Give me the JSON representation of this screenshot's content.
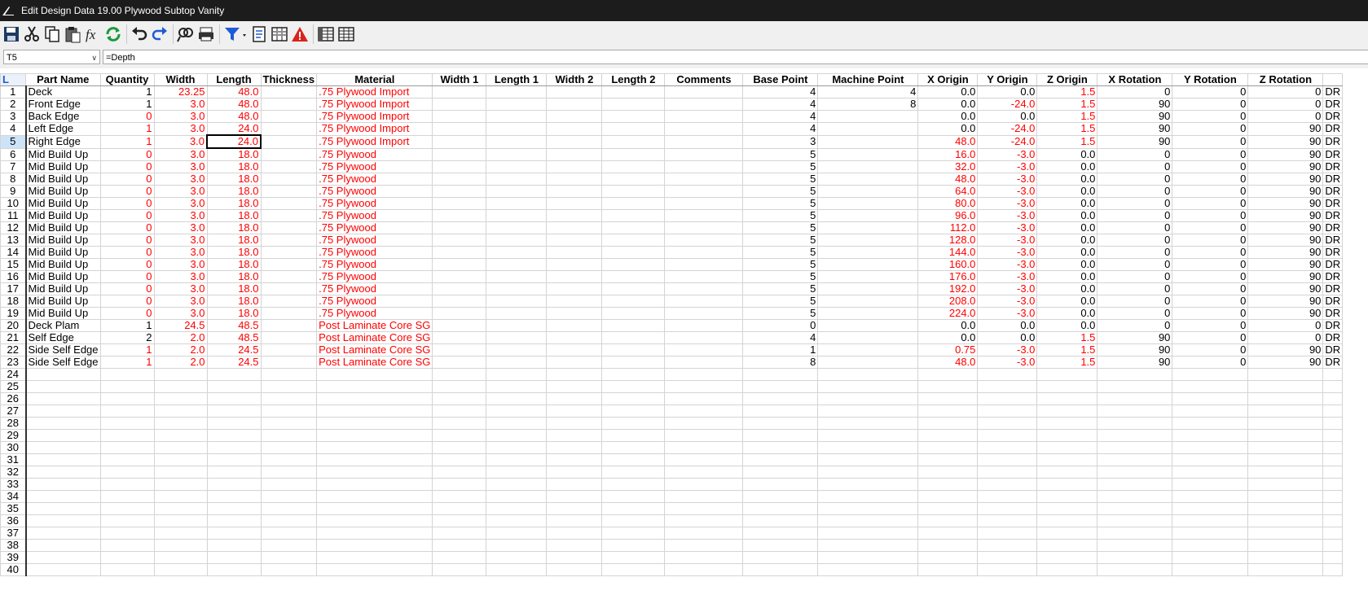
{
  "window": {
    "title": "Edit Design Data 19.00 Plywood Subtop Vanity"
  },
  "toolbar": {
    "buttons": [
      {
        "icon": "save-icon"
      },
      {
        "icon": "cut-icon"
      },
      {
        "icon": "copy-icon"
      },
      {
        "icon": "paste-icon"
      },
      {
        "icon": "function-icon"
      },
      {
        "icon": "refresh-icon"
      },
      {
        "icon": "undo-icon"
      },
      {
        "icon": "redo-icon"
      },
      {
        "icon": "find-replace-icon"
      },
      {
        "icon": "print-icon"
      },
      {
        "icon": "filter-icon"
      },
      {
        "icon": "properties-icon"
      },
      {
        "icon": "columns-icon"
      },
      {
        "icon": "warning-icon"
      },
      {
        "icon": "grid-view-icon"
      },
      {
        "icon": "table-view-icon"
      }
    ]
  },
  "formula_bar": {
    "cell_ref": "T5",
    "formula": "=Depth"
  },
  "grid": {
    "corner": "L",
    "columns": [
      "Part Name",
      "Quantity",
      "Width",
      "Length",
      "Thickness",
      "Material",
      "Width 1",
      "Length 1",
      "Width 2",
      "Length 2",
      "Comments",
      "Base Point",
      "Machine Point",
      "X Origin",
      "Y Origin",
      "Z Origin",
      "X Rotation",
      "Y Rotation",
      "Z Rotation",
      ""
    ],
    "active_cell": {
      "row": 5,
      "column": "Length"
    },
    "rows": [
      {
        "n": "1",
        "name": "Deck",
        "qty": "1",
        "w": "23.25",
        "l": "48.0",
        "t": "",
        "mat": ".75 Plywood Import",
        "w1": "",
        "l1": "",
        "w2": "",
        "l2": "",
        "cm": "",
        "bp": "4",
        "mp": "4",
        "xo": "0.0",
        "yo": "0.0",
        "zo": "1.5",
        "xr": "0",
        "yr": "0",
        "zr": "0",
        "ex": "DR"
      },
      {
        "n": "2",
        "name": "Front Edge",
        "qty": "1",
        "w": "3.0",
        "l": "48.0",
        "t": "",
        "mat": ".75 Plywood Import",
        "w1": "",
        "l1": "",
        "w2": "",
        "l2": "",
        "cm": "",
        "bp": "4",
        "mp": "8",
        "xo": "0.0",
        "yo": "-24.0",
        "zo": "1.5",
        "xr": "90",
        "yr": "0",
        "zr": "0",
        "ex": "DR"
      },
      {
        "n": "3",
        "name": "Back Edge",
        "qty": "0",
        "w": "3.0",
        "l": "48.0",
        "t": "",
        "mat": ".75 Plywood Import",
        "w1": "",
        "l1": "",
        "w2": "",
        "l2": "",
        "cm": "",
        "bp": "4",
        "mp": "",
        "xo": "0.0",
        "yo": "0.0",
        "zo": "1.5",
        "xr": "90",
        "yr": "0",
        "zr": "0",
        "ex": "DR"
      },
      {
        "n": "4",
        "name": "Left Edge",
        "qty": "1",
        "w": "3.0",
        "l": "24.0",
        "t": "",
        "mat": ".75 Plywood Import",
        "w1": "",
        "l1": "",
        "w2": "",
        "l2": "",
        "cm": "",
        "bp": "4",
        "mp": "",
        "xo": "0.0",
        "yo": "-24.0",
        "zo": "1.5",
        "xr": "90",
        "yr": "0",
        "zr": "90",
        "ex": "DR"
      },
      {
        "n": "5",
        "name": "Right Edge",
        "qty": "1",
        "w": "3.0",
        "l": "24.0",
        "t": "",
        "mat": ".75 Plywood Import",
        "w1": "",
        "l1": "",
        "w2": "",
        "l2": "",
        "cm": "",
        "bp": "3",
        "mp": "",
        "xo": "48.0",
        "yo": "-24.0",
        "zo": "1.5",
        "xr": "90",
        "yr": "0",
        "zr": "90",
        "ex": "DR"
      },
      {
        "n": "6",
        "name": "Mid Build Up",
        "qty": "0",
        "w": "3.0",
        "l": "18.0",
        "t": "",
        "mat": ".75 Plywood",
        "w1": "",
        "l1": "",
        "w2": "",
        "l2": "",
        "cm": "",
        "bp": "5",
        "mp": "",
        "xo": "16.0",
        "yo": "-3.0",
        "zo": "0.0",
        "xr": "0",
        "yr": "0",
        "zr": "90",
        "ex": "DR"
      },
      {
        "n": "7",
        "name": "Mid Build Up",
        "qty": "0",
        "w": "3.0",
        "l": "18.0",
        "t": "",
        "mat": ".75 Plywood",
        "w1": "",
        "l1": "",
        "w2": "",
        "l2": "",
        "cm": "",
        "bp": "5",
        "mp": "",
        "xo": "32.0",
        "yo": "-3.0",
        "zo": "0.0",
        "xr": "0",
        "yr": "0",
        "zr": "90",
        "ex": "DR"
      },
      {
        "n": "8",
        "name": "Mid Build Up",
        "qty": "0",
        "w": "3.0",
        "l": "18.0",
        "t": "",
        "mat": ".75 Plywood",
        "w1": "",
        "l1": "",
        "w2": "",
        "l2": "",
        "cm": "",
        "bp": "5",
        "mp": "",
        "xo": "48.0",
        "yo": "-3.0",
        "zo": "0.0",
        "xr": "0",
        "yr": "0",
        "zr": "90",
        "ex": "DR"
      },
      {
        "n": "9",
        "name": "Mid Build Up",
        "qty": "0",
        "w": "3.0",
        "l": "18.0",
        "t": "",
        "mat": ".75 Plywood",
        "w1": "",
        "l1": "",
        "w2": "",
        "l2": "",
        "cm": "",
        "bp": "5",
        "mp": "",
        "xo": "64.0",
        "yo": "-3.0",
        "zo": "0.0",
        "xr": "0",
        "yr": "0",
        "zr": "90",
        "ex": "DR"
      },
      {
        "n": "10",
        "name": "Mid Build Up",
        "qty": "0",
        "w": "3.0",
        "l": "18.0",
        "t": "",
        "mat": ".75 Plywood",
        "w1": "",
        "l1": "",
        "w2": "",
        "l2": "",
        "cm": "",
        "bp": "5",
        "mp": "",
        "xo": "80.0",
        "yo": "-3.0",
        "zo": "0.0",
        "xr": "0",
        "yr": "0",
        "zr": "90",
        "ex": "DR"
      },
      {
        "n": "11",
        "name": "Mid Build Up",
        "qty": "0",
        "w": "3.0",
        "l": "18.0",
        "t": "",
        "mat": ".75 Plywood",
        "w1": "",
        "l1": "",
        "w2": "",
        "l2": "",
        "cm": "",
        "bp": "5",
        "mp": "",
        "xo": "96.0",
        "yo": "-3.0",
        "zo": "0.0",
        "xr": "0",
        "yr": "0",
        "zr": "90",
        "ex": "DR"
      },
      {
        "n": "12",
        "name": "Mid Build Up",
        "qty": "0",
        "w": "3.0",
        "l": "18.0",
        "t": "",
        "mat": ".75 Plywood",
        "w1": "",
        "l1": "",
        "w2": "",
        "l2": "",
        "cm": "",
        "bp": "5",
        "mp": "",
        "xo": "112.0",
        "yo": "-3.0",
        "zo": "0.0",
        "xr": "0",
        "yr": "0",
        "zr": "90",
        "ex": "DR"
      },
      {
        "n": "13",
        "name": "Mid Build Up",
        "qty": "0",
        "w": "3.0",
        "l": "18.0",
        "t": "",
        "mat": ".75 Plywood",
        "w1": "",
        "l1": "",
        "w2": "",
        "l2": "",
        "cm": "",
        "bp": "5",
        "mp": "",
        "xo": "128.0",
        "yo": "-3.0",
        "zo": "0.0",
        "xr": "0",
        "yr": "0",
        "zr": "90",
        "ex": "DR"
      },
      {
        "n": "14",
        "name": "Mid Build Up",
        "qty": "0",
        "w": "3.0",
        "l": "18.0",
        "t": "",
        "mat": ".75 Plywood",
        "w1": "",
        "l1": "",
        "w2": "",
        "l2": "",
        "cm": "",
        "bp": "5",
        "mp": "",
        "xo": "144.0",
        "yo": "-3.0",
        "zo": "0.0",
        "xr": "0",
        "yr": "0",
        "zr": "90",
        "ex": "DR"
      },
      {
        "n": "15",
        "name": "Mid Build Up",
        "qty": "0",
        "w": "3.0",
        "l": "18.0",
        "t": "",
        "mat": ".75 Plywood",
        "w1": "",
        "l1": "",
        "w2": "",
        "l2": "",
        "cm": "",
        "bp": "5",
        "mp": "",
        "xo": "160.0",
        "yo": "-3.0",
        "zo": "0.0",
        "xr": "0",
        "yr": "0",
        "zr": "90",
        "ex": "DR"
      },
      {
        "n": "16",
        "name": "Mid Build Up",
        "qty": "0",
        "w": "3.0",
        "l": "18.0",
        "t": "",
        "mat": ".75 Plywood",
        "w1": "",
        "l1": "",
        "w2": "",
        "l2": "",
        "cm": "",
        "bp": "5",
        "mp": "",
        "xo": "176.0",
        "yo": "-3.0",
        "zo": "0.0",
        "xr": "0",
        "yr": "0",
        "zr": "90",
        "ex": "DR"
      },
      {
        "n": "17",
        "name": "Mid Build Up",
        "qty": "0",
        "w": "3.0",
        "l": "18.0",
        "t": "",
        "mat": ".75 Plywood",
        "w1": "",
        "l1": "",
        "w2": "",
        "l2": "",
        "cm": "",
        "bp": "5",
        "mp": "",
        "xo": "192.0",
        "yo": "-3.0",
        "zo": "0.0",
        "xr": "0",
        "yr": "0",
        "zr": "90",
        "ex": "DR"
      },
      {
        "n": "18",
        "name": "Mid Build Up",
        "qty": "0",
        "w": "3.0",
        "l": "18.0",
        "t": "",
        "mat": ".75 Plywood",
        "w1": "",
        "l1": "",
        "w2": "",
        "l2": "",
        "cm": "",
        "bp": "5",
        "mp": "",
        "xo": "208.0",
        "yo": "-3.0",
        "zo": "0.0",
        "xr": "0",
        "yr": "0",
        "zr": "90",
        "ex": "DR"
      },
      {
        "n": "19",
        "name": "Mid Build Up",
        "qty": "0",
        "w": "3.0",
        "l": "18.0",
        "t": "",
        "mat": ".75 Plywood",
        "w1": "",
        "l1": "",
        "w2": "",
        "l2": "",
        "cm": "",
        "bp": "5",
        "mp": "",
        "xo": "224.0",
        "yo": "-3.0",
        "zo": "0.0",
        "xr": "0",
        "yr": "0",
        "zr": "90",
        "ex": "DR"
      },
      {
        "n": "20",
        "name": "Deck Plam",
        "qty": "1",
        "w": "24.5",
        "l": "48.5",
        "t": "",
        "mat": "Post Laminate Core SG",
        "w1": "",
        "l1": "",
        "w2": "",
        "l2": "",
        "cm": "",
        "bp": "0",
        "mp": "",
        "xo": "0.0",
        "yo": "0.0",
        "zo": "0.0",
        "xr": "0",
        "yr": "0",
        "zr": "0",
        "ex": "DR"
      },
      {
        "n": "21",
        "name": "Self Edge",
        "qty": "2",
        "w": "2.0",
        "l": "48.5",
        "t": "",
        "mat": "Post Laminate Core SG",
        "w1": "",
        "l1": "",
        "w2": "",
        "l2": "",
        "cm": "",
        "bp": "4",
        "mp": "",
        "xo": "0.0",
        "yo": "0.0",
        "zo": "1.5",
        "xr": "90",
        "yr": "0",
        "zr": "0",
        "ex": "DR"
      },
      {
        "n": "22",
        "name": "Side Self Edge",
        "qty": "1",
        "w": "2.0",
        "l": "24.5",
        "t": "",
        "mat": "Post Laminate Core SG",
        "w1": "",
        "l1": "",
        "w2": "",
        "l2": "",
        "cm": "",
        "bp": "1",
        "mp": "",
        "xo": "0.75",
        "yo": "-3.0",
        "zo": "1.5",
        "xr": "90",
        "yr": "0",
        "zr": "90",
        "ex": "DR"
      },
      {
        "n": "23",
        "name": "Side Self Edge",
        "qty": "1",
        "w": "2.0",
        "l": "24.5",
        "t": "",
        "mat": "Post Laminate Core SG",
        "w1": "",
        "l1": "",
        "w2": "",
        "l2": "",
        "cm": "",
        "bp": "8",
        "mp": "",
        "xo": "48.0",
        "yo": "-3.0",
        "zo": "1.5",
        "xr": "90",
        "yr": "0",
        "zr": "90",
        "ex": "DR"
      },
      {
        "n": "24"
      },
      {
        "n": "25"
      },
      {
        "n": "26"
      },
      {
        "n": "27"
      },
      {
        "n": "28"
      },
      {
        "n": "29"
      },
      {
        "n": "30"
      },
      {
        "n": "31"
      },
      {
        "n": "32"
      },
      {
        "n": "33"
      },
      {
        "n": "34"
      },
      {
        "n": "35"
      },
      {
        "n": "36"
      },
      {
        "n": "37"
      },
      {
        "n": "38"
      },
      {
        "n": "39"
      },
      {
        "n": "40"
      }
    ],
    "red_cells": {
      "qty_black_rows": [
        "1",
        "2",
        "20",
        "21"
      ],
      "xo_red_rows": [
        "5",
        "6",
        "7",
        "8",
        "9",
        "10",
        "11",
        "12",
        "13",
        "14",
        "15",
        "16",
        "17",
        "18",
        "19",
        "22",
        "23"
      ],
      "yo_red_rows": [
        "2",
        "4",
        "5",
        "6",
        "7",
        "8",
        "9",
        "10",
        "11",
        "12",
        "13",
        "14",
        "15",
        "16",
        "17",
        "18",
        "19",
        "22",
        "23"
      ],
      "zo_red_rows": [
        "1",
        "2",
        "3",
        "4",
        "5",
        "21",
        "22",
        "23"
      ]
    },
    "colors": {
      "red": "#ff0000",
      "black": "#000000",
      "selected_row_header": "#cde3f7"
    }
  }
}
